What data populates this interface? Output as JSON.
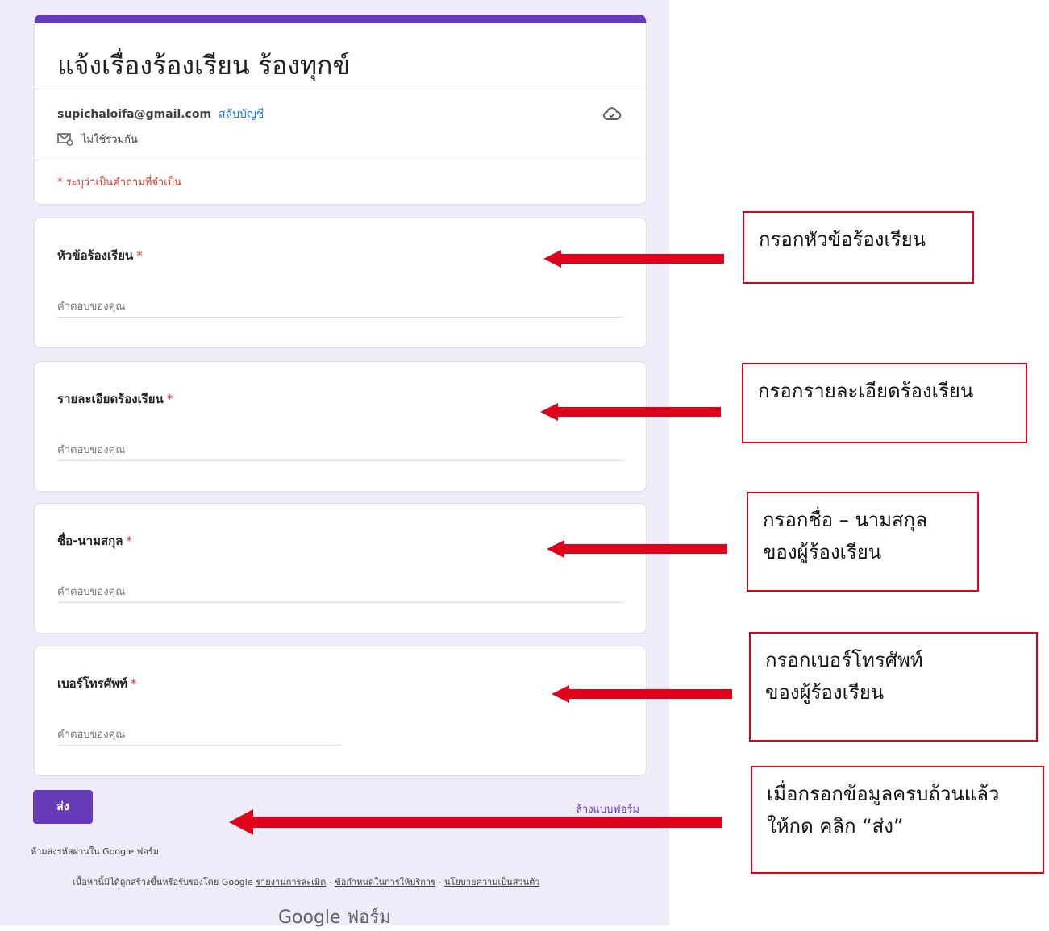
{
  "form": {
    "title": "แจ้งเรื่องร้องเรียน ร้องทุกข์",
    "accent_color": "#673ab7",
    "account_email": "supichaloifa@gmail.com",
    "switch_account": "สลับบัญชี",
    "not_shared": "ไม่ใช้ร่วมกัน",
    "required_note": "* ระบุว่าเป็นคำถามที่จำเป็น",
    "questions": [
      {
        "label": "หัวข้อร้องเรียน",
        "required": "*",
        "placeholder": "คำตอบของคุณ"
      },
      {
        "label": "รายละเอียดร้องเรียน",
        "required": "*",
        "placeholder": "คำตอบของคุณ"
      },
      {
        "label": "ชื่อ-นามสกุล",
        "required": "*",
        "placeholder": "คำตอบของคุณ"
      },
      {
        "label": "เบอร์โทรศัพท์",
        "required": "*",
        "placeholder": "คำตอบของคุณ"
      }
    ],
    "submit_label": "ส่ง",
    "clear_label": "ล้างแบบฟอร์ม",
    "password_warning": "ห้ามส่งรหัสผ่านใน Google ฟอร์ม",
    "footer_text": "เนื้อหานี้มิได้ถูกสร้างขึ้นหรือรับรองโดย Google",
    "footer_links": [
      "รายงานการละเมิด",
      "ข้อกำหนดในการให้บริการ",
      "นโยบายความเป็นส่วนตัว"
    ],
    "footer_sep": " - ",
    "brand": "Google ฟอร์ม"
  },
  "annotations": {
    "arrow_color": "#e0001a",
    "callouts": [
      {
        "line1": "กรอกหัวข้อร้องเรียน",
        "line2": ""
      },
      {
        "line1": "กรอกรายละเอียดร้องเรียน",
        "line2": ""
      },
      {
        "line1": "กรอกชื่อ – นามสกุล",
        "line2": "ของผู้ร้องเรียน"
      },
      {
        "line1": "กรอกเบอร์โทรศัพท์",
        "line2": "ของผู้ร้องเรียน"
      },
      {
        "line1": "เมื่อกรอกข้อมูลครบถ้วนแล้ว",
        "line2": "ให้กด คลิก “ส่ง”"
      }
    ]
  }
}
